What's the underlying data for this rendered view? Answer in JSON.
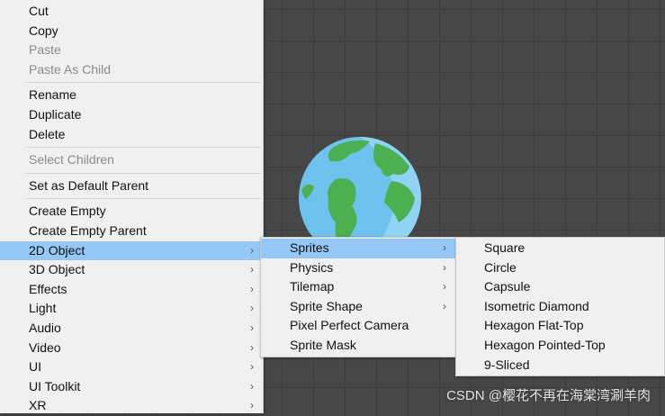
{
  "main_menu": {
    "items": [
      {
        "label": "Cut",
        "state": "enabled",
        "arrow": false
      },
      {
        "label": "Copy",
        "state": "enabled",
        "arrow": false
      },
      {
        "label": "Paste",
        "state": "disabled",
        "arrow": false
      },
      {
        "label": "Paste As Child",
        "state": "disabled",
        "arrow": false
      },
      {
        "separator": true
      },
      {
        "label": "Rename",
        "state": "enabled",
        "arrow": false
      },
      {
        "label": "Duplicate",
        "state": "enabled",
        "arrow": false
      },
      {
        "label": "Delete",
        "state": "enabled",
        "arrow": false
      },
      {
        "separator": true
      },
      {
        "label": "Select Children",
        "state": "disabled",
        "arrow": false
      },
      {
        "separator": true
      },
      {
        "label": "Set as Default Parent",
        "state": "enabled",
        "arrow": false
      },
      {
        "separator": true
      },
      {
        "label": "Create Empty",
        "state": "enabled",
        "arrow": false
      },
      {
        "label": "Create Empty Parent",
        "state": "enabled",
        "arrow": false
      },
      {
        "label": "2D Object",
        "state": "highlighted",
        "arrow": true
      },
      {
        "label": "3D Object",
        "state": "enabled",
        "arrow": true
      },
      {
        "label": "Effects",
        "state": "enabled",
        "arrow": true
      },
      {
        "label": "Light",
        "state": "enabled",
        "arrow": true
      },
      {
        "label": "Audio",
        "state": "enabled",
        "arrow": true
      },
      {
        "label": "Video",
        "state": "enabled",
        "arrow": true
      },
      {
        "label": "UI",
        "state": "enabled",
        "arrow": true
      },
      {
        "label": "UI Toolkit",
        "state": "enabled",
        "arrow": true
      },
      {
        "label": "XR",
        "state": "enabled",
        "arrow": true
      }
    ]
  },
  "submenu_2d_object": {
    "items": [
      {
        "label": "Sprites",
        "state": "highlighted",
        "arrow": true
      },
      {
        "label": "Physics",
        "state": "enabled",
        "arrow": true
      },
      {
        "label": "Tilemap",
        "state": "enabled",
        "arrow": true
      },
      {
        "label": "Sprite Shape",
        "state": "enabled",
        "arrow": true
      },
      {
        "label": "Pixel Perfect Camera",
        "state": "enabled",
        "arrow": false
      },
      {
        "label": "Sprite Mask",
        "state": "enabled",
        "arrow": false
      }
    ]
  },
  "submenu_sprites": {
    "items": [
      {
        "label": "Square"
      },
      {
        "label": "Circle"
      },
      {
        "label": "Capsule"
      },
      {
        "label": "Isometric Diamond"
      },
      {
        "label": "Hexagon Flat-Top"
      },
      {
        "label": "Hexagon Pointed-Top"
      },
      {
        "label": "9-Sliced"
      }
    ]
  },
  "scene": {
    "object_icon": "earth-globe-icon"
  },
  "watermark": "CSDN @樱花不再在海棠湾涮羊肉",
  "arrow_glyph": "›",
  "colors": {
    "highlight": "#95c8f4",
    "menu_bg": "#f0f0f0",
    "disabled_text": "#8a8a8a",
    "scene_bg": "#474747"
  }
}
